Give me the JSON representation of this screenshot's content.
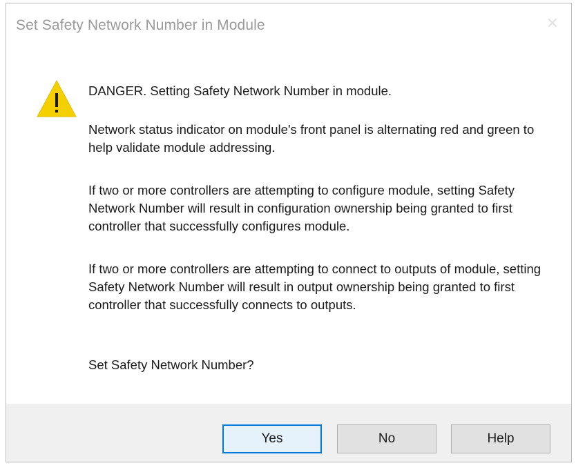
{
  "window": {
    "title": "Set Safety Network Number in Module",
    "close_glyph": "✕"
  },
  "message": {
    "icon": "warning-icon",
    "icon_color": "#f5d000",
    "paragraphs": [
      "DANGER. Setting Safety Network Number in module.",
      "Network status indicator on module's front panel is alternating red and green to help validate module addressing.",
      "If two or more controllers are attempting to configure module, setting Safety Network Number will result in configuration ownership being granted to first controller that successfully configures module.",
      "If two or more controllers are attempting to connect to outputs of module, setting Safety Network Number will result in output ownership being granted to first controller that successfully connects to outputs.",
      "Set Safety Network Number?"
    ]
  },
  "buttons": {
    "yes": "Yes",
    "no": "No",
    "help": "Help"
  }
}
